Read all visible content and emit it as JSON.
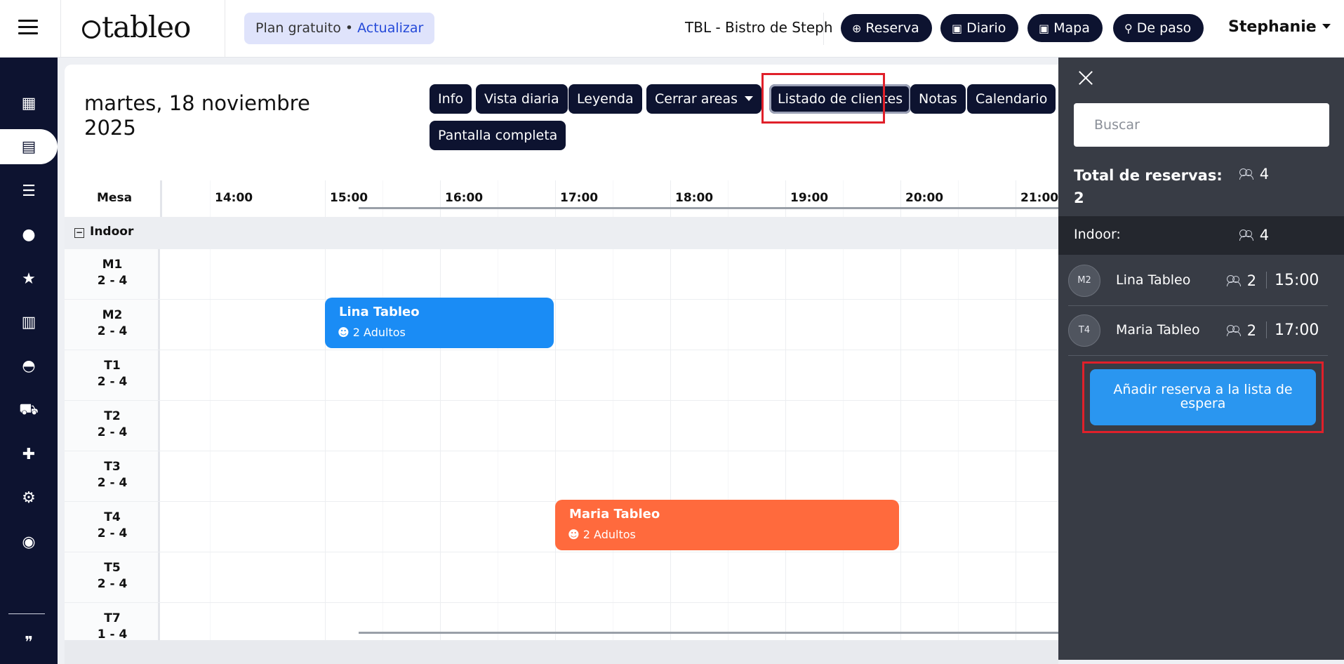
{
  "topbar": {
    "logo": "tableo",
    "plan_label": "Plan gratuito",
    "plan_sep": " • ",
    "plan_upgrade": "Actualizar",
    "venue": "TBL - Bistro de Steph",
    "buttons": [
      {
        "label": "Reserva",
        "icon": "plus-circle-icon"
      },
      {
        "label": "Diario",
        "icon": "calendar-icon"
      },
      {
        "label": "Mapa",
        "icon": "map-calendar-icon"
      },
      {
        "label": "De paso",
        "icon": "walking-icon"
      }
    ],
    "user": "Stephanie"
  },
  "sidebar": {
    "items": [
      {
        "name": "dashboard-icon",
        "glyph": "▦"
      },
      {
        "name": "book-icon",
        "glyph": "▤",
        "active": true
      },
      {
        "name": "list-icon",
        "glyph": "☰"
      },
      {
        "name": "user-icon",
        "glyph": "●"
      },
      {
        "name": "star-icon",
        "glyph": "★"
      },
      {
        "name": "chart-icon",
        "glyph": "▥"
      },
      {
        "name": "bell-icon",
        "glyph": "◓"
      },
      {
        "name": "cart-icon",
        "glyph": "⛟"
      },
      {
        "name": "puzzle-icon",
        "glyph": "✚"
      },
      {
        "name": "gear-icon",
        "glyph": "⚙"
      },
      {
        "name": "headset-icon",
        "glyph": "◉"
      },
      {
        "name": "chat-icon",
        "glyph": "❞"
      }
    ]
  },
  "main": {
    "date_line1": "martes, 18 noviembre",
    "date_line2": "2025",
    "toolbar": {
      "info": "Info",
      "vista_diaria": "Vista diaria",
      "leyenda": "Leyenda",
      "cerrar_areas": "Cerrar areas",
      "listado_clientes": "Listado de clientes",
      "notas": "Notas",
      "calendario": "Calendario",
      "pantalla_completa": "Pantalla completa"
    },
    "grid": {
      "mesa_header": "Mesa",
      "times": [
        "14:00",
        "15:00",
        "16:00",
        "17:00",
        "18:00",
        "19:00",
        "20:00",
        "21:00"
      ],
      "area": "Indoor",
      "area_toggle": "−",
      "tables": [
        {
          "name": "M1",
          "cap": "2 - 4"
        },
        {
          "name": "M2",
          "cap": "2 - 4"
        },
        {
          "name": "T1",
          "cap": "2 - 4"
        },
        {
          "name": "T2",
          "cap": "2 - 4"
        },
        {
          "name": "T3",
          "cap": "2 - 4"
        },
        {
          "name": "T4",
          "cap": "2 - 4"
        },
        {
          "name": "T5",
          "cap": "2 - 4"
        },
        {
          "name": "T7",
          "cap": "1 - 4"
        }
      ],
      "reservations": [
        {
          "name": "Lina Tableo",
          "guests": "2 Adultos",
          "table": "M2",
          "color": "#1a8cf5"
        },
        {
          "name": "Maria Tableo",
          "guests": "2 Adultos",
          "table": "T4",
          "color": "#ff6a3d"
        }
      ]
    }
  },
  "panel": {
    "search_placeholder": "Buscar",
    "total_label_1": "Total de reservas:",
    "total_label_2": "2",
    "total_people": "4",
    "area_label": "Indoor:",
    "area_people": "4",
    "clients": [
      {
        "table": "M2",
        "name": "Lina Tableo",
        "people": "2",
        "time": "15:00"
      },
      {
        "table": "T4",
        "name": "Maria Tableo",
        "people": "2",
        "time": "17:00"
      }
    ],
    "waitlist_button": "Añadir reserva a la lista de espera"
  }
}
